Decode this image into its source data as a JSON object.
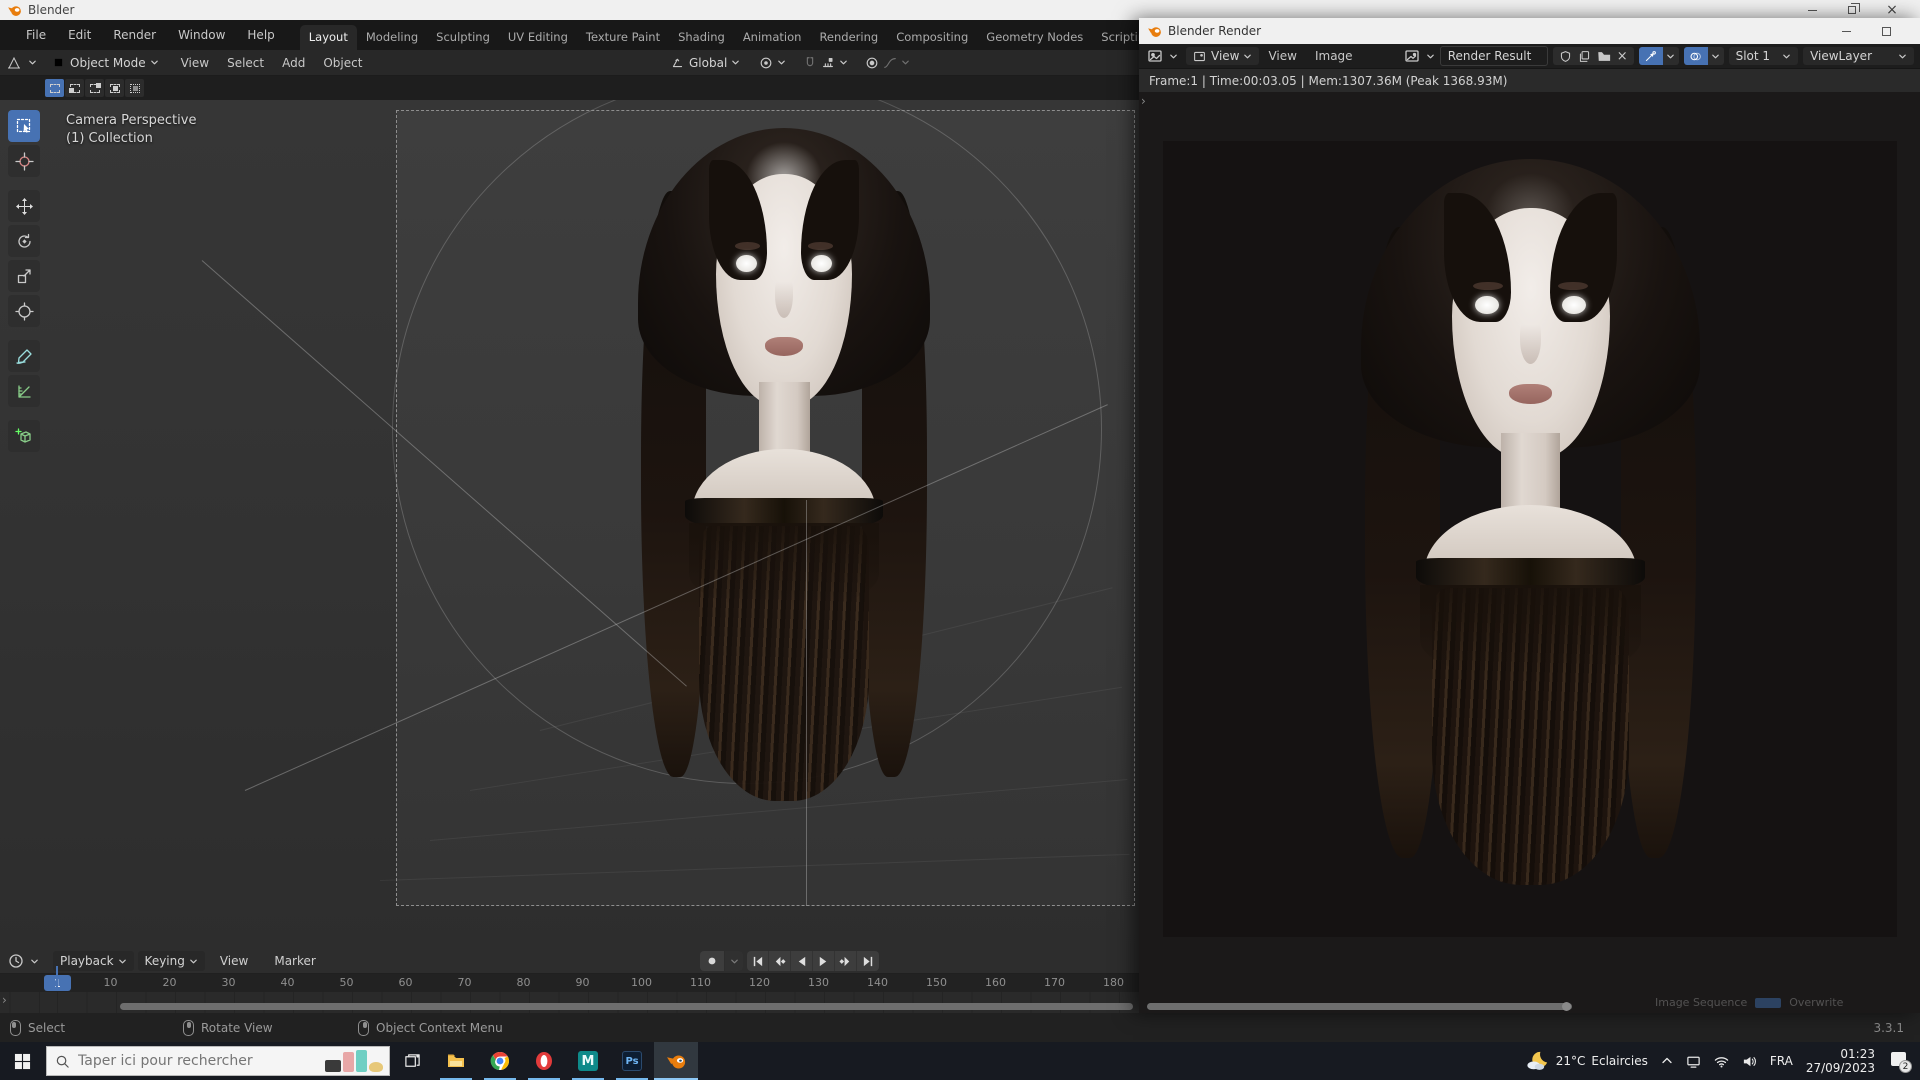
{
  "titlebar": {
    "app_title": "Blender"
  },
  "menubar": {
    "items": [
      "File",
      "Edit",
      "Render",
      "Window",
      "Help"
    ]
  },
  "workspaces": {
    "active": "Layout",
    "tabs": [
      "Layout",
      "Modeling",
      "Sculpting",
      "UV Editing",
      "Texture Paint",
      "Shading",
      "Animation",
      "Rendering",
      "Compositing",
      "Geometry Nodes",
      "Scripting"
    ],
    "new_tab": "+"
  },
  "tool_header": {
    "mode": "Object Mode",
    "menu_view": "View",
    "menu_select": "Select",
    "menu_add": "Add",
    "menu_object": "Object",
    "orientation": "Global"
  },
  "viewport": {
    "header_line1": "Camera Perspective",
    "header_line2": "(1) Collection"
  },
  "timeline": {
    "menu_playback": "Playback",
    "menu_keying": "Keying",
    "menu_view": "View",
    "menu_marker": "Marker",
    "current_frame": "1",
    "ticks": [
      "10",
      "20",
      "30",
      "40",
      "50",
      "60",
      "70",
      "80",
      "90",
      "100",
      "110",
      "120",
      "130",
      "140",
      "150",
      "160",
      "170",
      "180"
    ]
  },
  "statusbar": {
    "hint_left": "Select",
    "hint_middle": "Rotate View",
    "hint_right": "Object Context Menu",
    "version": "3.3.1"
  },
  "render_window": {
    "title": "Blender Render",
    "mode": "View",
    "menu_view": "View",
    "menu_image": "Image",
    "datablock": "Render Result",
    "slot": "Slot 1",
    "view_layer": "ViewLayer",
    "stats": "Frame:1 | Time:00:03.05 | Mem:1307.36M (Peak 1368.93M)",
    "footer_label": "Image Sequence",
    "footer_toggle": "Overwrite"
  },
  "taskbar": {
    "search_placeholder": "Taper ici pour rechercher",
    "weather_temp": "21°C",
    "weather_desc": "Eclaircies",
    "language": "FRA",
    "time": "01:23",
    "date": "27/09/2023",
    "notification_count": "2"
  },
  "colors": {
    "accent_blue": "#4772b3",
    "blender_orange": "#e87d0d",
    "taskbar_indicator": "#76b9ed"
  }
}
